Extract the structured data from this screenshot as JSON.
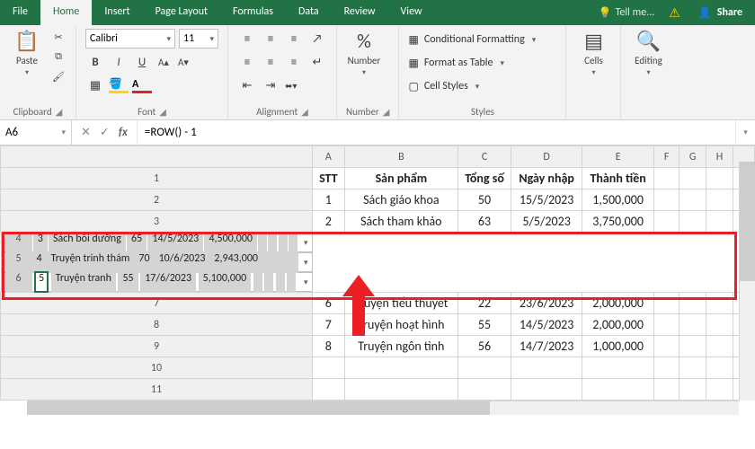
{
  "tabs": {
    "file": "File",
    "home": "Home",
    "insert": "Insert",
    "page_layout": "Page Layout",
    "formulas": "Formulas",
    "data": "Data",
    "review": "Review",
    "view": "View"
  },
  "titlebar": {
    "tell_me": "Tell me...",
    "share": "Share"
  },
  "ribbon": {
    "clipboard": {
      "label": "Clipboard",
      "paste": "Paste"
    },
    "font": {
      "label": "Font",
      "name": "Calibri",
      "size": "11"
    },
    "alignment": {
      "label": "Alignment"
    },
    "number": {
      "label": "Number",
      "btn": "Number",
      "pct": "%"
    },
    "styles": {
      "label": "Styles",
      "cond": "Conditional Formatting",
      "table": "Format as Table",
      "cell": "Cell Styles"
    },
    "cells": {
      "label": "Cells"
    },
    "editing": {
      "label": "Editing"
    }
  },
  "formula_bar": {
    "name_box": "A6",
    "formula": "=ROW() - 1"
  },
  "columns": [
    "A",
    "B",
    "C",
    "D",
    "E",
    "F",
    "G",
    "H"
  ],
  "rows": [
    "1",
    "2",
    "3",
    "4",
    "5",
    "6",
    "7",
    "8",
    "9",
    "10",
    "11"
  ],
  "header_row": {
    "stt": "STT",
    "product": "Sản phẩm",
    "total": "Tổng số",
    "date": "Ngày nhập",
    "amount": "Thành tiền"
  },
  "data_rows": [
    {
      "stt": "1",
      "product": "Sách giáo khoa",
      "total": "50",
      "date": "15/5/2023",
      "amount": "1,500,000"
    },
    {
      "stt": "2",
      "product": "Sách tham khảo",
      "total": "63",
      "date": "5/5/2023",
      "amount": "3,750,000"
    },
    {
      "stt": "3",
      "product": "Sách bồi dưỡng",
      "total": "65",
      "date": "14/5/2023",
      "amount": "4,500,000"
    },
    {
      "stt": "4",
      "product": "Truyện trinh thám",
      "total": "70",
      "date": "10/6/2023",
      "amount": "2,943,000"
    },
    {
      "stt": "5",
      "product": "Truyện tranh",
      "total": "55",
      "date": "17/6/2023",
      "amount": "5,100,000"
    },
    {
      "stt": "6",
      "product": "Truyện tiểu thuyết",
      "total": "22",
      "date": "23/6/2023",
      "amount": "2,000,000"
    },
    {
      "stt": "7",
      "product": "Truyện hoạt hình",
      "total": "55",
      "date": "14/5/2023",
      "amount": "2,000,000"
    },
    {
      "stt": "8",
      "product": "Truyện ngôn tình",
      "total": "56",
      "date": "14/7/2023",
      "amount": "1,000,000"
    }
  ]
}
